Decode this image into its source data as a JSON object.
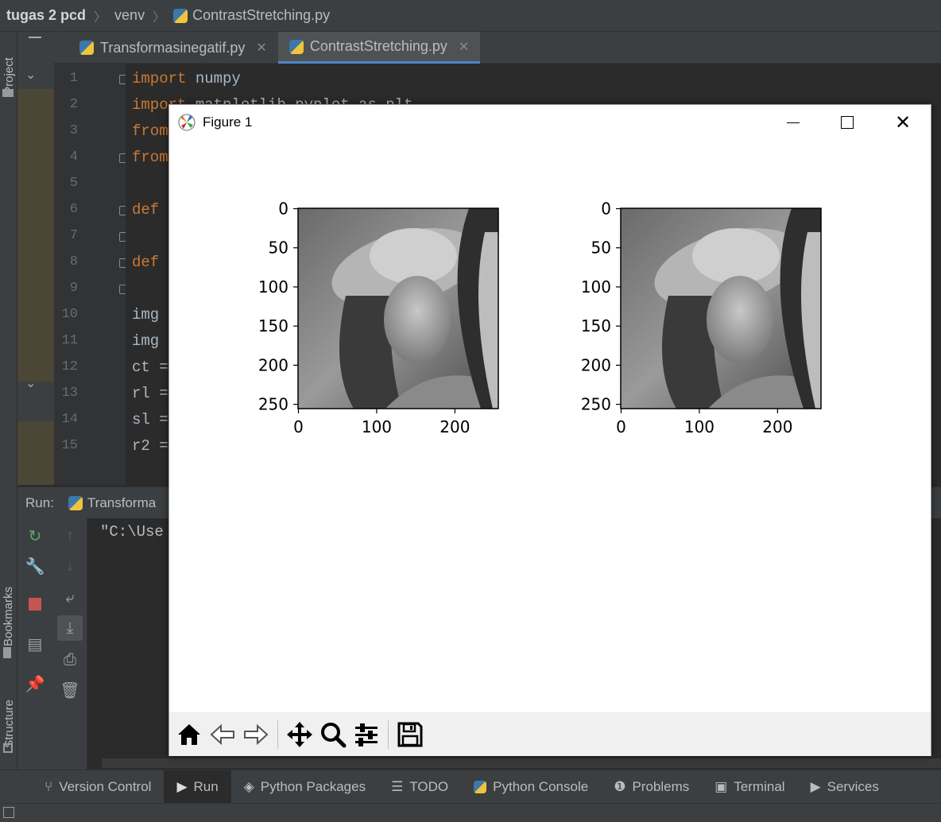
{
  "breadcrumb": {
    "project": "tugas 2 pcd",
    "folder": "venv",
    "file": "ContrastStretching.py"
  },
  "left_stripe": {
    "project_label": "Project",
    "bookmarks_label": "Bookmarks",
    "structure_label": "Structure"
  },
  "tabs": [
    {
      "label": "Transformasinegatif.py",
      "active": false
    },
    {
      "label": "ContrastStretching.py",
      "active": true
    }
  ],
  "editor": {
    "line_numbers": [
      "1",
      "2",
      "3",
      "4",
      "5",
      "6",
      "7",
      "8",
      "9",
      "10",
      "11",
      "12",
      "13",
      "14",
      "15"
    ],
    "lines": [
      {
        "kw": "import",
        "rest": " numpy"
      },
      {
        "kw": "import",
        "rest": " matplotlib.pyplot as plt"
      },
      {
        "kw": "from",
        "rest": ""
      },
      {
        "kw": "from",
        "rest": ""
      },
      {
        "kw": "",
        "rest": ""
      },
      {
        "kw": "def",
        "rest": ""
      },
      {
        "kw": "",
        "rest": ""
      },
      {
        "kw": "def",
        "rest": ""
      },
      {
        "kw": "",
        "rest": ""
      },
      {
        "kw": "",
        "rest": "img"
      },
      {
        "kw": "",
        "rest": "img"
      },
      {
        "kw": "",
        "rest": "ct ="
      },
      {
        "kw": "",
        "rest": "rl ="
      },
      {
        "kw": "",
        "rest": "sl ="
      },
      {
        "kw": "",
        "rest": "r2 ="
      }
    ]
  },
  "run": {
    "label": "Run:",
    "config": "Transforma",
    "console_text": "\"C:\\Use"
  },
  "bottom_bar": [
    {
      "label": "Version Control",
      "icon": "branch-icon"
    },
    {
      "label": "Run",
      "icon": "play-icon",
      "active": true
    },
    {
      "label": "Python Packages",
      "icon": "layers-icon"
    },
    {
      "label": "TODO",
      "icon": "list-icon"
    },
    {
      "label": "Python Console",
      "icon": "python-icon"
    },
    {
      "label": "Problems",
      "icon": "warning-icon"
    },
    {
      "label": "Terminal",
      "icon": "terminal-icon"
    },
    {
      "label": "Services",
      "icon": "services-icon"
    }
  ],
  "figure": {
    "title": "Figure 1",
    "plots": [
      {
        "yticks": [
          "0",
          "50",
          "100",
          "150",
          "200",
          "250"
        ],
        "xticks": [
          "0",
          "100",
          "200"
        ]
      },
      {
        "yticks": [
          "0",
          "50",
          "100",
          "150",
          "200",
          "250"
        ],
        "xticks": [
          "0",
          "100",
          "200"
        ]
      }
    ],
    "toolbar": [
      "home-icon",
      "back-icon",
      "forward-icon",
      "pan-icon",
      "zoom-icon",
      "configure-icon",
      "save-icon"
    ]
  },
  "colors": {
    "accent": "#4a88c7",
    "keyword": "#cc7832",
    "stop": "#c75450",
    "rerun": "#59a869"
  }
}
